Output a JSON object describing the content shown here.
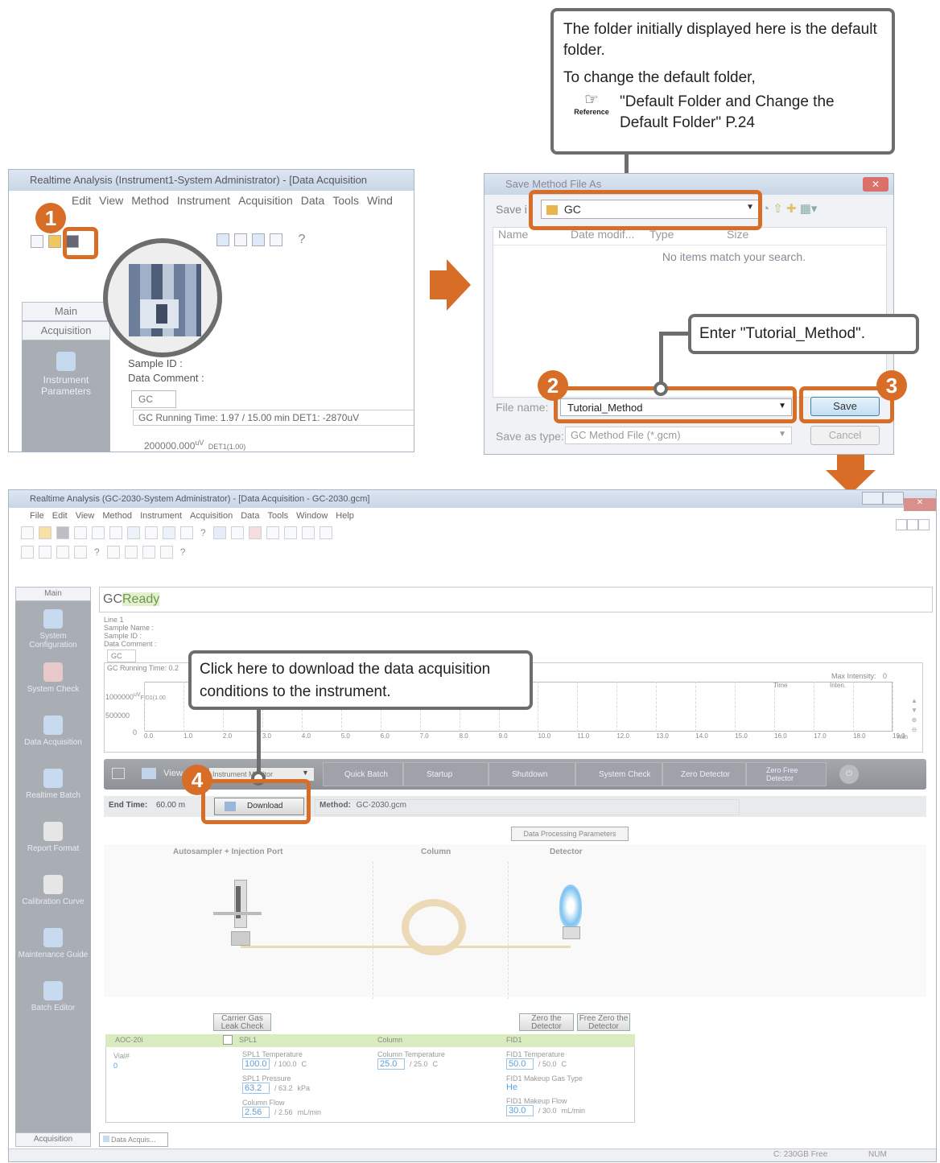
{
  "callouts": {
    "default_folder": {
      "line1": "The folder initially displayed here is the default folder.",
      "line2": "To change the default folder,",
      "ref_label": "Reference",
      "ref_text": "\"Default Folder and Change the Default Folder\" P.24"
    },
    "enter_name": "Enter \"Tutorial_Method\".",
    "download": "Click here to download the data acquisition conditions to the instrument."
  },
  "steps": [
    "1",
    "2",
    "3",
    "4"
  ],
  "screen1": {
    "title": "Realtime Analysis (Instrument1-System Administrator) - [Data Acquisition",
    "menu": [
      "Edit",
      "View",
      "Method",
      "Instrument",
      "Acquisition",
      "Data",
      "Tools",
      "Wind"
    ],
    "tabs": [
      "Main",
      "Acquisition"
    ],
    "sidebar_item": "Instrument Parameters",
    "sample_id": "Sample ID :",
    "data_comment": "Data Comment :",
    "gc_tab": "GC",
    "running": "GC Running Time: 1.97 / 15.00 min DET1: -2870uV",
    "yvalue": "200000.000",
    "yunit": "uV",
    "det": "DET1(1.00)"
  },
  "dialog": {
    "title": "Save Method File As",
    "save_in": "Save i",
    "folder": "GC",
    "columns": [
      "Name",
      "Date modif...",
      "Type",
      "Size"
    ],
    "empty": "No items match your search.",
    "file_name_label": "File name:",
    "file_name": "Tutorial_Method",
    "save_type_label": "Save as type:",
    "save_type": "GC Method File (*.gcm)",
    "save": "Save",
    "cancel": "Cancel"
  },
  "main": {
    "title": "Realtime Analysis (GC-2030-System Administrator) - [Data Acquisition - GC-2030.gcm]",
    "menu": [
      "File",
      "Edit",
      "View",
      "Method",
      "Instrument",
      "Acquisition",
      "Data",
      "Tools",
      "Window",
      "Help"
    ],
    "sidebar": [
      "Main",
      "System Configuration",
      "System Check",
      "Data Acquisition",
      "Realtime Batch",
      "Report Format",
      "Calibration Curve",
      "Maintenance Guide",
      "Batch Editor"
    ],
    "sidebar_bottom": "Acquisition",
    "status_gc": "GC",
    "status_ready": "Ready",
    "info": [
      "Line 1",
      "Sample Name :",
      "Sample ID :",
      "Data Comment :"
    ],
    "gc_tab": "GC",
    "running": "GC Running Time: 0.2",
    "max_int": "Max Intensity:",
    "max_int_value": "0",
    "time_label": "Time",
    "inten_label": "Inten.",
    "y_ticks": [
      "1000000",
      "500000",
      "0"
    ],
    "y_unit": "uV",
    "trace": "FID1(1.00",
    "x_ticks": [
      "0.0",
      "1.0",
      "2.0",
      "3.0",
      "4.0",
      "5.0",
      "6.0",
      "7.0",
      "8.0",
      "9.0",
      "10.0",
      "11.0",
      "12.0",
      "13.0",
      "14.0",
      "15.0",
      "16.0",
      "17.0",
      "18.0",
      "19.0"
    ],
    "x_unit": "min",
    "toolbar_view": "View",
    "toolbar_view_value": "Instrument Monitor",
    "buttons": [
      "Quick Batch",
      "Startup",
      "Shutdown",
      "System Check",
      "Zero Detector",
      "Zero Free Detector"
    ],
    "end_time_label": "End Time:",
    "end_time": "60.00 m",
    "download": "Download",
    "method_label": "Method:",
    "method": "GC-2030.gcm",
    "dpp": "Data Processing Parameters",
    "section_labels": [
      "Autosampler + Injection Port",
      "Column",
      "Detector"
    ],
    "carrier": "Carrier Gas Leak Check",
    "zero_det": "Zero the Detector",
    "free_zero": "Free Zero the Detector",
    "table_heads": [
      "AOC-20i",
      "SPL1",
      "Column",
      "FID1"
    ],
    "vial_label": "Vial#",
    "vial_value": "0",
    "spl1": [
      {
        "label": "SPL1 Temperature",
        "value": "100.0",
        "set": "/ 100.0",
        "unit": "C"
      },
      {
        "label": "SPL1 Pressure",
        "value": "63.2",
        "set": "/ 63.2",
        "unit": "kPa"
      },
      {
        "label": "Column Flow",
        "value": "2.56",
        "set": "/ 2.56",
        "unit": "mL/min"
      }
    ],
    "column": {
      "label": "Column Temperature",
      "value": "25.0",
      "set": "/ 25.0",
      "unit": "C"
    },
    "fid": [
      {
        "label": "FID1 Temperature",
        "value": "50.0",
        "set": "/ 50.0",
        "unit": "C"
      },
      {
        "label": "FID1 Makeup Gas Type",
        "value": "He",
        "set": "",
        "unit": ""
      },
      {
        "label": "FID1 Makeup Flow",
        "value": "30.0",
        "set": "/ 30.0",
        "unit": "mL/min"
      }
    ],
    "bottom_tab": "Data Acquis...",
    "status_free": "C:  230GB Free",
    "status_num": "NUM"
  }
}
